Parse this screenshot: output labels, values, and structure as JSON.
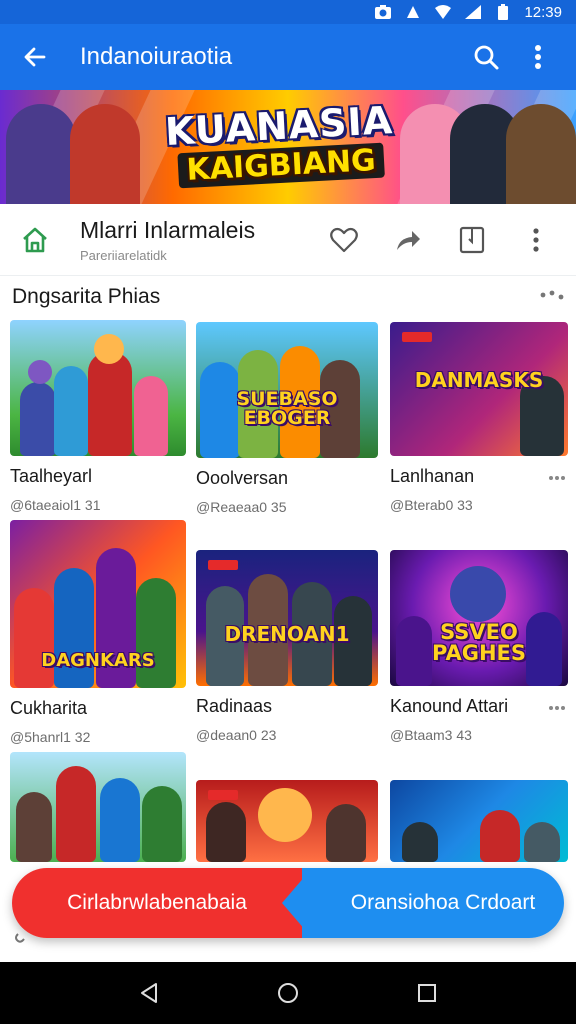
{
  "status_bar": {
    "time": "12:39"
  },
  "app_bar": {
    "title": "Indanoiuraotia"
  },
  "banner": {
    "title_line1": "KUANASIA",
    "title_line2": "KAIGBIANG"
  },
  "header": {
    "title": "Mlarri Inlarmaleis",
    "subtitle": "Pareriiarelatidk"
  },
  "section": {
    "title": "Dngsarita Phias"
  },
  "cards": [
    {
      "title": "Taalheyarl",
      "subtitle": "@6taeaiol1 31",
      "art_text": ""
    },
    {
      "title": "Ooolversan",
      "subtitle": "@Reaeaa0 35",
      "art_text": "SUEBASO EBOGER"
    },
    {
      "title": "Lanlhanan",
      "subtitle": "@Bterab0 33",
      "art_text": "DANMASKS"
    },
    {
      "title": "Cukharita",
      "subtitle": "@5hanrl1 32",
      "art_text": "DAGNKARS"
    },
    {
      "title": "Radinaas",
      "subtitle": "@deaan0 23",
      "art_text": "DRENOAN1"
    },
    {
      "title": "Kanound Attari",
      "subtitle": "@Btaam3 43",
      "art_text": "SSVEO PAGHES"
    },
    {
      "title": "",
      "subtitle": "",
      "art_text": ""
    },
    {
      "title": "",
      "subtitle": "",
      "art_text": ""
    },
    {
      "title": "",
      "subtitle": "",
      "art_text": ""
    }
  ],
  "actions": {
    "left_label": "Cirlabrwlabenabaia",
    "right_label": "Oransiohoa Crdoart"
  },
  "colors": {
    "app_bar": "#1a72e8",
    "fab_left": "#f0302e",
    "fab_right": "#1e8ef0",
    "home_icon": "#2e9b4f"
  }
}
